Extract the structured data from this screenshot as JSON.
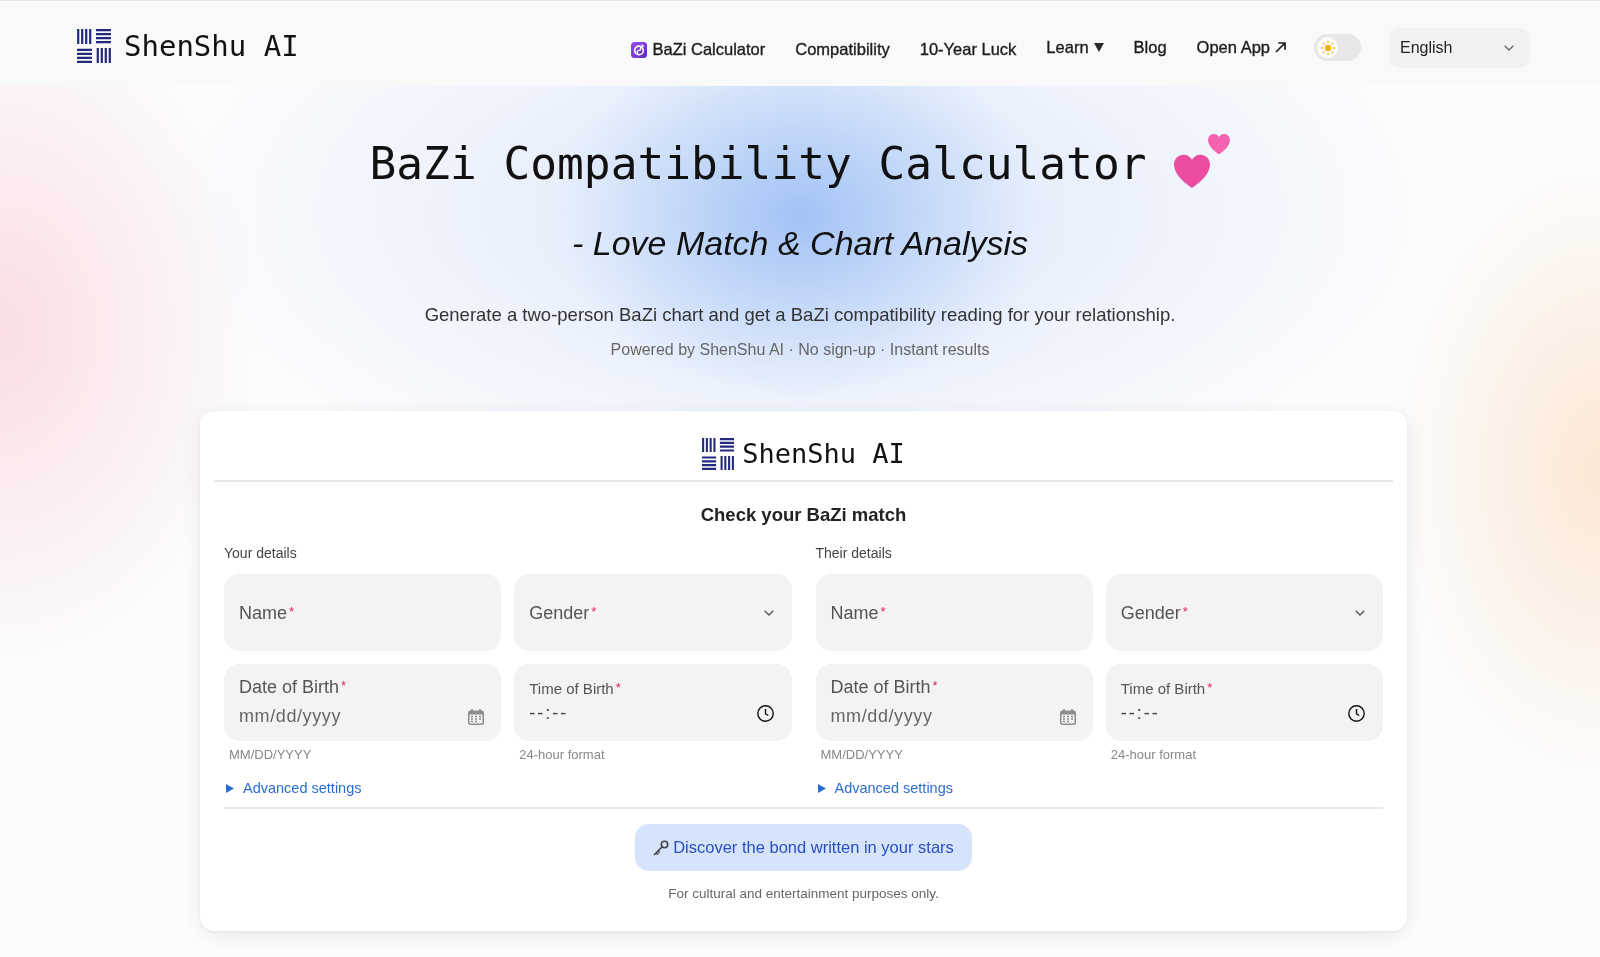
{
  "header": {
    "logo": "ShenShu AI",
    "nav": [
      {
        "label": "BaZi Calculator",
        "kind": "app"
      },
      {
        "label": "Compatibility",
        "kind": "link"
      },
      {
        "label": "10-Year Luck",
        "kind": "link"
      },
      {
        "label": "Learn",
        "kind": "menu"
      },
      {
        "label": "Blog",
        "kind": "link"
      },
      {
        "label": "Open App",
        "kind": "external"
      }
    ],
    "theme_toggle": {
      "on": false
    },
    "language": {
      "value": "English"
    }
  },
  "hero": {
    "title": "BaZi Compatibility Calculator",
    "subtitle": "- Love Match & Chart Analysis",
    "description": "Generate a two-person BaZi chart and get a BaZi compatibility reading for your relationship.",
    "tagline": "Powered by ShenShu AI · No sign-up · Instant results"
  },
  "form_card": {
    "logo": "ShenShu AI",
    "heading": "Check your BaZi match",
    "people": [
      {
        "label": "Your details",
        "fields": [
          {
            "kind": "text",
            "label": "Name",
            "required_mark": "*"
          },
          {
            "kind": "select",
            "label": "Gender",
            "required_mark": "*"
          },
          {
            "kind": "date",
            "label": "Date of Birth",
            "required_mark": "*",
            "placeholder": "mm/dd/yyyy",
            "hint": "MM/DD/YYYY"
          },
          {
            "kind": "time",
            "label": "Time of Birth",
            "required_mark": "*",
            "placeholder": "--:--",
            "hint": "24-hour format"
          }
        ],
        "advanced": {
          "label": "Advanced settings",
          "expanded": false
        }
      },
      {
        "label": "Their details",
        "fields": [
          {
            "kind": "text",
            "label": "Name",
            "required_mark": "*"
          },
          {
            "kind": "select",
            "label": "Gender",
            "required_mark": "*"
          },
          {
            "kind": "date",
            "label": "Date of Birth",
            "required_mark": "*",
            "placeholder": "mm/dd/yyyy",
            "hint": "MM/DD/YYYY"
          },
          {
            "kind": "time",
            "label": "Time of Birth",
            "required_mark": "*",
            "placeholder": "--:--",
            "hint": "24-hour format"
          }
        ],
        "advanced": {
          "label": "Advanced settings",
          "expanded": false
        }
      }
    ],
    "submit": {
      "label": "Discover the bond written in your stars"
    },
    "disclaimer": "For cultural and entertainment purposes only."
  }
}
